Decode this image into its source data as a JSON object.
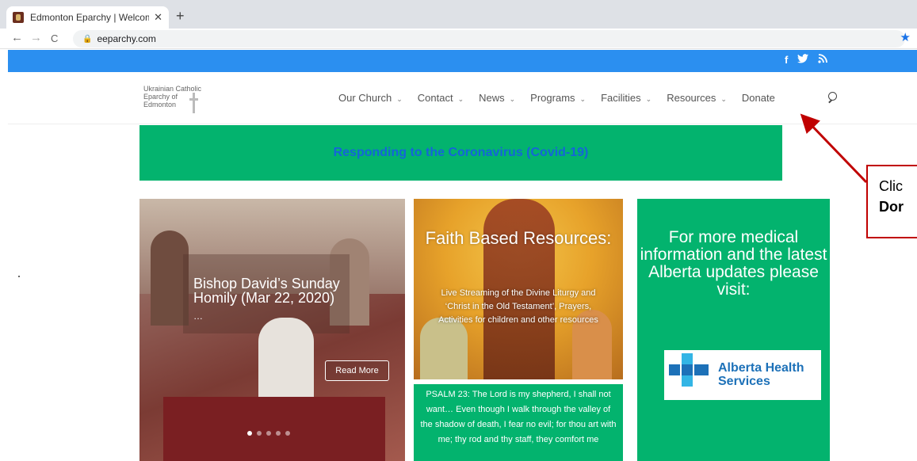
{
  "browser": {
    "tab_title": "Edmonton Eparchy | Welcome to",
    "tab_close": "✕",
    "new_tab": "+",
    "back": "←",
    "forward": "→",
    "reload": "C",
    "url": "eeparchy.com",
    "bookmark_star": "★"
  },
  "social": [
    "f",
    "🐦",
    "⋰"
  ],
  "logo": {
    "line1": "Ukrainian Catholic",
    "line2": "Eparchy of",
    "line3": "Edmonton"
  },
  "nav": {
    "items": [
      {
        "label": "Our Church",
        "dropdown": true
      },
      {
        "label": "Contact",
        "dropdown": true
      },
      {
        "label": "News",
        "dropdown": true
      },
      {
        "label": "Programs",
        "dropdown": true
      },
      {
        "label": "Facilities",
        "dropdown": true
      },
      {
        "label": "Resources",
        "dropdown": true
      },
      {
        "label": "Donate",
        "dropdown": false
      }
    ],
    "chevron": "⌄"
  },
  "banner": {
    "text": "Responding to the Coronavirus (Covid-19)"
  },
  "slider": {
    "title": "Bishop David’s Sunday Homily (Mar 22, 2020)",
    "ellipsis": "…",
    "button": "Read More",
    "dot_count": 5,
    "active_dot": 1
  },
  "faith": {
    "title": "Faith Based Resources:",
    "description": "Live Streaming of the Divine Liturgy and ‘Christ in the Old Testament’, Prayers, Activities for children and other resources"
  },
  "psalm": {
    "text": "PSALM 23: The Lord is my shepherd, I shall not want… Even though I walk through the valley of the shadow of death, I fear no evil; for thou art with me; thy rod and thy staff, they comfort me"
  },
  "health": {
    "text": "For more medical information and the latest Alberta updates please visit:",
    "logo_line1": "Alberta Health",
    "logo_line2": "Services"
  },
  "annotation": {
    "line1": "Clic",
    "line2": "Dor",
    "color": "#c00000"
  },
  "colors": {
    "green": "#03b36e",
    "blue_bar": "#2b8ff0",
    "banner_text": "#1565d8"
  }
}
